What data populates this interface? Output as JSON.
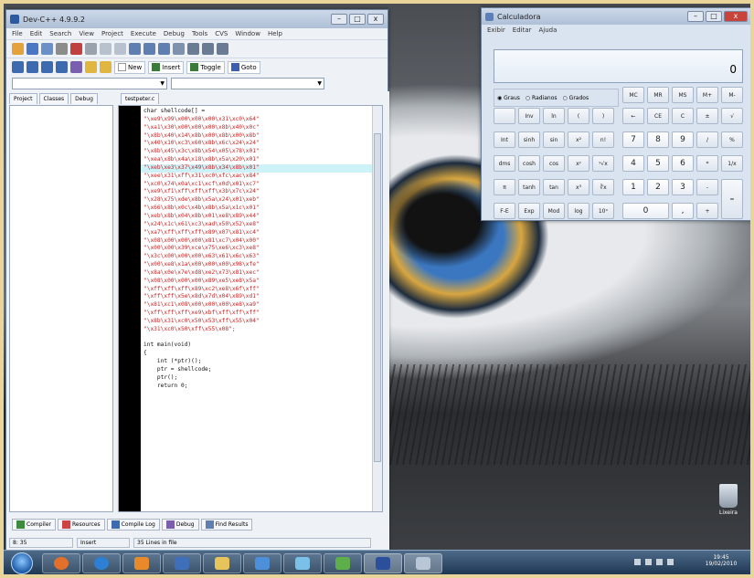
{
  "devcpp": {
    "title": "Dev-C++ 4.9.9.2",
    "menu": [
      "File",
      "Edit",
      "Search",
      "View",
      "Project",
      "Execute",
      "Debug",
      "Tools",
      "CVS",
      "Window",
      "Help"
    ],
    "toolbar": {
      "new": "New",
      "insert": "Insert",
      "toggle": "Toggle",
      "goto": "Goto"
    },
    "left_tabs": [
      "Project",
      "Classes",
      "Debug"
    ],
    "file_tab": "testpeter.c",
    "code": [
      "char shellcode[] =",
      "\"\\xe9\\x99\\x00\\x00\\x00\\x31\\xc0\\x64\"",
      "\"\\xa1\\x30\\x00\\x00\\x00\\x8b\\x40\\x0c\"",
      "\"\\x8b\\x40\\x14\\x8b\\x00\\x8b\\x00\\x8b\"",
      "\"\\x40\\x10\\xc3\\x60\\x8b\\x6c\\x24\\x24\"",
      "\"\\x8b\\x45\\x3c\\x8b\\x54\\x05\\x78\\x01\"",
      "\"\\xea\\x8b\\x4a\\x18\\x8b\\x5a\\x20\\x01\"",
      "\"\\xeb\\xe3\\x37\\x49\\x8b\\x34\\x8b\\x01\"",
      "\"\\xee\\x31\\xff\\x31\\xc0\\xfc\\xac\\x84\"",
      "\"\\xc0\\x74\\x0a\\xc1\\xcf\\x0d\\x01\\xc7\"",
      "\"\\xe9\\xf1\\xff\\xff\\xff\\x3b\\x7c\\x24\"",
      "\"\\x28\\x75\\xde\\x8b\\x5a\\x24\\x01\\xeb\"",
      "\"\\x66\\x8b\\x0c\\x4b\\x8b\\x5a\\x1c\\x01\"",
      "\"\\xeb\\x8b\\x04\\x8b\\x01\\xe8\\x89\\x44\"",
      "\"\\x24\\x1c\\x61\\xc3\\xad\\x50\\x52\\xe8\"",
      "\"\\xa7\\xff\\xff\\xff\\x89\\x07\\x81\\xc4\"",
      "\"\\x08\\x00\\x00\\x00\\x81\\xc7\\x04\\x00\"",
      "\"\\x00\\x00\\x39\\xce\\x75\\xe6\\xc3\\xe8\"",
      "\"\\x3c\\x00\\x00\\x00\\x63\\x61\\x6c\\x63\"",
      "\"\\x00\\xe8\\x1a\\x00\\x00\\x00\\x98\\xfe\"",
      "\"\\x8a\\x0e\\x7e\\xd8\\xe2\\x73\\x81\\xec\"",
      "\"\\x08\\x00\\x00\\x00\\x89\\xe5\\xe8\\x5a\"",
      "\"\\xff\\xff\\xff\\x89\\xc2\\xe8\\x6f\\xff\"",
      "\"\\xff\\xff\\x5e\\x8d\\x7d\\x04\\x89\\xd1\"",
      "\"\\x81\\xc1\\x08\\x00\\x00\\x00\\xe8\\xa9\"",
      "\"\\xff\\xff\\xff\\xe9\\xbf\\xff\\xff\\xff\"",
      "\"\\x8b\\x31\\xc0\\x50\\x53\\xff\\x55\\x04\"",
      "\"\\x31\\xc0\\x50\\xff\\x55\\x08\";",
      "",
      "int main(void)",
      "{",
      "    int (*ptr)();",
      "    ptr = shellcode;",
      "    ptr();",
      "    return 0;"
    ],
    "bottom_tabs": [
      "Compiler",
      "Resources",
      "Compile Log",
      "Debug",
      "Find Results"
    ],
    "status": {
      "pos": "8: 35",
      "mode": "Insert",
      "lines": "35 Lines in file"
    }
  },
  "calc": {
    "title": "Calculadora",
    "menu": [
      "Exibir",
      "Editar",
      "Ajuda"
    ],
    "display": "0",
    "angle": [
      "Graus",
      "Radianos",
      "Grados"
    ],
    "rows": [
      [
        "",
        "Inv",
        "ln",
        "(",
        ")",
        "←",
        "CE",
        "C",
        "±",
        "√"
      ],
      [
        "Int",
        "sinh",
        "sin",
        "x²",
        "n!",
        "7",
        "8",
        "9",
        "/",
        "%"
      ],
      [
        "dms",
        "cosh",
        "cos",
        "xʸ",
        "ʸ√x",
        "4",
        "5",
        "6",
        "*",
        "1/x"
      ],
      [
        "π",
        "tanh",
        "tan",
        "x³",
        "∛x",
        "1",
        "2",
        "3",
        "-",
        ""
      ],
      [
        "F-E",
        "Exp",
        "Mod",
        "log",
        "10ˣ",
        "0",
        "",
        ",",
        "+",
        ""
      ]
    ],
    "mem": [
      "MC",
      "MR",
      "MS",
      "M+",
      "M-"
    ],
    "equals": "="
  },
  "desktop": {
    "recycle": "Lixeira"
  },
  "tray": {
    "time": "19:45",
    "date": "19/02/2010"
  }
}
